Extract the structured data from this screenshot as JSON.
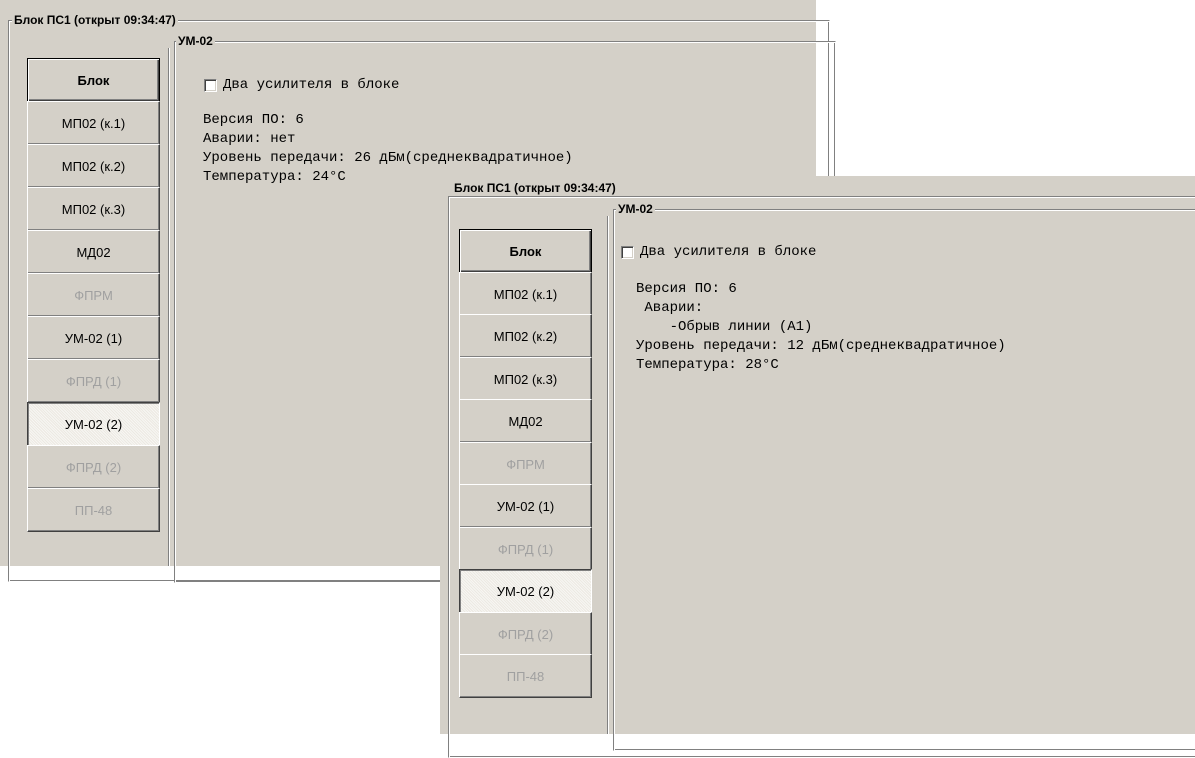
{
  "windows": [
    {
      "block_title": "Блок ПС1 (открыт 09:34:47)",
      "module_title": "УМ-02",
      "checkbox_label": "Два усилителя в блоке",
      "info_lines": [
        "Версия ПО: 6",
        "Аварии: нет",
        "Уровень передачи: 26 дБм(среднеквадратичное)",
        "Температура: 24°C"
      ],
      "buttons": [
        {
          "label": "Блок",
          "state": "bold"
        },
        {
          "label": "МП02 (к.1)",
          "state": "normal"
        },
        {
          "label": "МП02 (к.2)",
          "state": "normal"
        },
        {
          "label": "МП02 (к.3)",
          "state": "normal"
        },
        {
          "label": "МД02",
          "state": "normal"
        },
        {
          "label": "ФПРМ",
          "state": "disabled"
        },
        {
          "label": "УМ-02 (1)",
          "state": "normal"
        },
        {
          "label": "ФПРД (1)",
          "state": "disabled"
        },
        {
          "label": "УМ-02 (2)",
          "state": "pressed"
        },
        {
          "label": "ФПРД (2)",
          "state": "disabled"
        },
        {
          "label": "ПП-48",
          "state": "disabled"
        }
      ]
    },
    {
      "block_title": "Блок ПС1 (открыт 09:34:47)",
      "module_title": "УМ-02",
      "checkbox_label": "Два усилителя в блоке",
      "info_lines": [
        "Версия ПО: 6",
        " Аварии:",
        "    -Обрыв линии (А1)",
        "Уровень передачи: 12 дБм(среднеквадратичное)",
        "Температура: 28°C"
      ],
      "buttons": [
        {
          "label": "Блок",
          "state": "bold"
        },
        {
          "label": "МП02 (к.1)",
          "state": "normal"
        },
        {
          "label": "МП02 (к.2)",
          "state": "normal"
        },
        {
          "label": "МП02 (к.3)",
          "state": "normal"
        },
        {
          "label": "МД02",
          "state": "normal"
        },
        {
          "label": "ФПРМ",
          "state": "disabled"
        },
        {
          "label": "УМ-02 (1)",
          "state": "normal"
        },
        {
          "label": "ФПРД (1)",
          "state": "disabled"
        },
        {
          "label": "УМ-02 (2)",
          "state": "pressed"
        },
        {
          "label": "ФПРД (2)",
          "state": "disabled"
        },
        {
          "label": "ПП-48",
          "state": "disabled"
        }
      ]
    }
  ]
}
